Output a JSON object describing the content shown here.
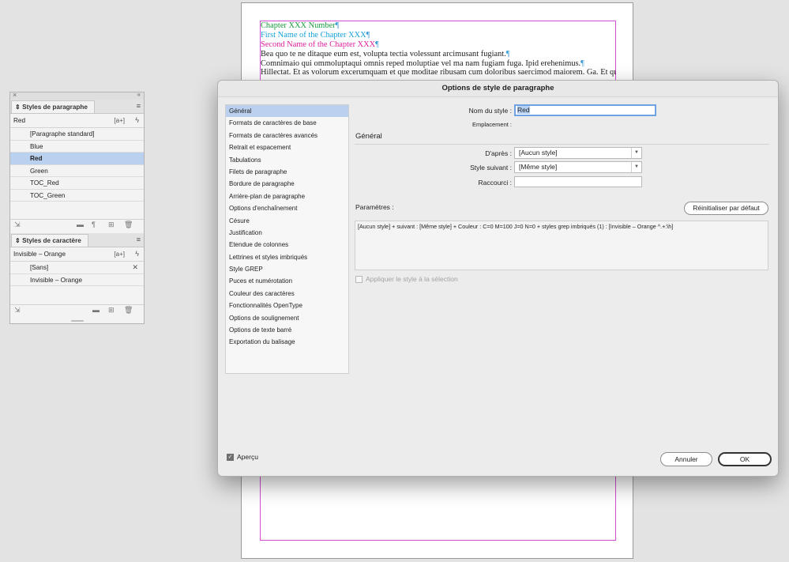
{
  "document": {
    "lines": [
      {
        "text": "Chapter XXX Number",
        "color": "green"
      },
      {
        "text": "First Name of the Chapter XXX",
        "color": "cyan"
      },
      {
        "text": "Second Name of the Chapter XXX",
        "color": "magenta"
      },
      {
        "text": "Bea quo te ne ditaque eum est, volupta tectia volessunt arcimusant fugiant.",
        "color": "black"
      },
      {
        "text": "Comnimaio qui ommoluptaqui omnis reped moluptiae vel ma nam fugiam fuga. Ipid erehenimus.",
        "color": "black"
      },
      {
        "text": "Hillectat. Et as volorum excerumquam et que moditae ribusam cum doloribus saercimod maiorem. Ga. Et quia-",
        "color": "black"
      }
    ],
    "pilcrow": "¶"
  },
  "panel": {
    "close_icon": "×",
    "collapse_icon": "«",
    "paragraph_styles": {
      "tab_label": "Styles de paragraphe",
      "current": "Red",
      "new_style_icon": "[a+]",
      "items": [
        "[Paragraphe standard]",
        "Blue",
        "Red",
        "Green",
        "TOC_Red",
        "TOC_Green"
      ],
      "selected_index": 2
    },
    "character_styles": {
      "tab_label": "Styles de caractère",
      "current": "Invisible – Orange",
      "new_style_icon": "[a+]",
      "items": [
        "[Sans]",
        "Invisible – Orange"
      ]
    }
  },
  "dialog": {
    "title": "Options de style de paragraphe",
    "categories": [
      "Général",
      "Formats de caractères de base",
      "Formats de caractères avancés",
      "Retrait et espacement",
      "Tabulations",
      "Filets de paragraphe",
      "Bordure de paragraphe",
      "Arrière-plan de paragraphe",
      "Options d'enchaînement",
      "Césure",
      "Justification",
      "Etendue de colonnes",
      "Lettrines et styles imbriqués",
      "Style GREP",
      "Puces et numérotation",
      "Couleur des caractères",
      "Fonctionnalités OpenType",
      "Options de soulignement",
      "Options de texte barré",
      "Exportation du balisage"
    ],
    "selected_category_index": 0,
    "style_name_label": "Nom du style :",
    "style_name_value": "Red",
    "location_label": "Emplacement :",
    "section_general": "Général",
    "based_on_label": "D'après :",
    "based_on_value": "[Aucun style]",
    "next_style_label": "Style suivant :",
    "next_style_value": "[Même style]",
    "shortcut_label": "Raccourci :",
    "shortcut_value": "",
    "params_label": "Paramètres :",
    "reset_button": "Réinitialiser par défaut",
    "params_text": "[Aucun style] + suivant : [Même style] + Couleur : C=0 M=100 J=0 N=0 + styles grep imbriqués (1) : [Invisible – Orange ^.+:\\h]",
    "apply_label": "Appliquer le style à la sélection",
    "preview_label": "Aperçu",
    "cancel_button": "Annuler",
    "ok_button": "OK"
  }
}
